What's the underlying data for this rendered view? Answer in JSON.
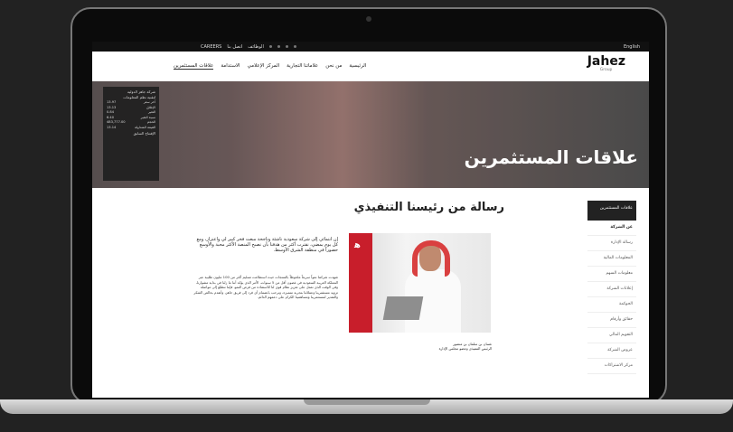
{
  "topbar": {
    "language": "English",
    "links": [
      "CAREERS",
      "اتصل بنا",
      "الوظائف"
    ]
  },
  "header": {
    "logo_main": "Jahez",
    "logo_sub": "Group",
    "nav": [
      "الرئيسية",
      "من نحن",
      "علاماتنا التجارية",
      "المركز الإعلامي",
      "الاستدامة",
      "علاقات المستثمرين"
    ]
  },
  "hero": {
    "title": "علاقات المستثمرين"
  },
  "stock": {
    "title": "شركة جاهز الدولية",
    "subtitle": "لتقنية نظم المعلومات",
    "rows": [
      [
        "آخر سعر",
        "13.97"
      ],
      [
        "الإغلاق",
        "13.13"
      ],
      [
        "التغير",
        "0.84"
      ],
      [
        "نسبة التغير",
        "6.40"
      ],
      [
        "الحجم",
        "483,777.00"
      ],
      [
        "القيمة المتداولة",
        "13.14"
      ]
    ],
    "footer": "الإفتتاح السابق"
  },
  "sidebar": {
    "head": "علاقات المستثمرين",
    "items": [
      "عن الشركة",
      "رسالة الإدارة",
      "المعلومات المالية",
      "معلومات السهم",
      "إعلانات الشركة",
      "الحوكمة",
      "حقائق وأرقام",
      "التقويم المالي",
      "عروض الشركة",
      "مركز الاشتراكات"
    ]
  },
  "main": {
    "title": "رسالة من رئيسنا التنفيذي",
    "lead": "إن انتمائي إلى شركة سعودية ناشئة وناجحة مبعث فخر كبير لي واعتزاز، ومع كل يوم يمضي، نقترب أكثر من هدفنا بأن نصبح المنصة الأكثر محبة والأوسع حضوراً في منطقة الشرق الأوسط.",
    "body": "شهدت شركتنا نمواً سريعاً ملحوظاً بالمنتجات حيث استطاعت تسليم أكثر من 100 مليون طلبية عبر المملكة العربية السعودية في غضون أقل من 5 سنوات، الأمر الذي يؤكد أننا ما زلنا في بداية مشوارنا، وفي الوقت الذي نعمل على تعزيز نظام قوي لنا للاستفادة من فرص النمو، فإننا نتطلع إلى مواصلة تزويد مستثمرينا وعملائنا بتجربة متميزة، ونرحب بانضمام أي فرد إلى فريق جاهز، وأتقدم بخالص الشكر والتقدير لمستثمرينا ومساهمينا الكرام على دعمهم الدائم.",
    "caption_name": "غسان بن سلمان بن منصور",
    "caption_role": "الرئيس التنفيذي وعضو مجلس الإدارة"
  }
}
